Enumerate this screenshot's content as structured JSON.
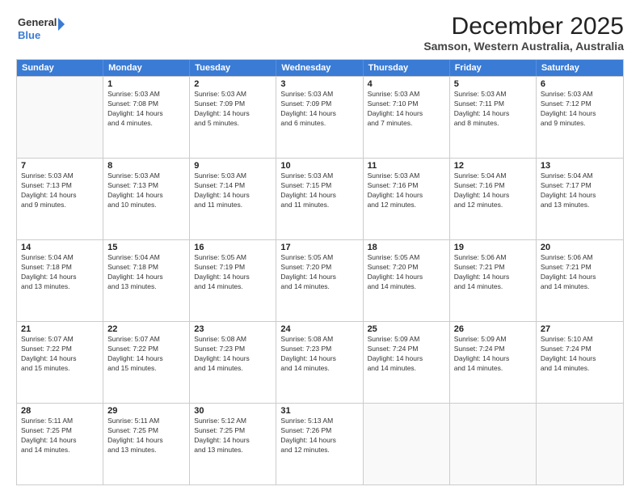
{
  "logo": {
    "line1": "General",
    "line2": "Blue"
  },
  "title": "December 2025",
  "subtitle": "Samson, Western Australia, Australia",
  "days_of_week": [
    "Sunday",
    "Monday",
    "Tuesday",
    "Wednesday",
    "Thursday",
    "Friday",
    "Saturday"
  ],
  "weeks": [
    [
      {
        "day": "",
        "info": ""
      },
      {
        "day": "1",
        "info": "Sunrise: 5:03 AM\nSunset: 7:08 PM\nDaylight: 14 hours\nand 4 minutes."
      },
      {
        "day": "2",
        "info": "Sunrise: 5:03 AM\nSunset: 7:09 PM\nDaylight: 14 hours\nand 5 minutes."
      },
      {
        "day": "3",
        "info": "Sunrise: 5:03 AM\nSunset: 7:09 PM\nDaylight: 14 hours\nand 6 minutes."
      },
      {
        "day": "4",
        "info": "Sunrise: 5:03 AM\nSunset: 7:10 PM\nDaylight: 14 hours\nand 7 minutes."
      },
      {
        "day": "5",
        "info": "Sunrise: 5:03 AM\nSunset: 7:11 PM\nDaylight: 14 hours\nand 8 minutes."
      },
      {
        "day": "6",
        "info": "Sunrise: 5:03 AM\nSunset: 7:12 PM\nDaylight: 14 hours\nand 9 minutes."
      }
    ],
    [
      {
        "day": "7",
        "info": "Sunrise: 5:03 AM\nSunset: 7:13 PM\nDaylight: 14 hours\nand 9 minutes."
      },
      {
        "day": "8",
        "info": "Sunrise: 5:03 AM\nSunset: 7:13 PM\nDaylight: 14 hours\nand 10 minutes."
      },
      {
        "day": "9",
        "info": "Sunrise: 5:03 AM\nSunset: 7:14 PM\nDaylight: 14 hours\nand 11 minutes."
      },
      {
        "day": "10",
        "info": "Sunrise: 5:03 AM\nSunset: 7:15 PM\nDaylight: 14 hours\nand 11 minutes."
      },
      {
        "day": "11",
        "info": "Sunrise: 5:03 AM\nSunset: 7:16 PM\nDaylight: 14 hours\nand 12 minutes."
      },
      {
        "day": "12",
        "info": "Sunrise: 5:04 AM\nSunset: 7:16 PM\nDaylight: 14 hours\nand 12 minutes."
      },
      {
        "day": "13",
        "info": "Sunrise: 5:04 AM\nSunset: 7:17 PM\nDaylight: 14 hours\nand 13 minutes."
      }
    ],
    [
      {
        "day": "14",
        "info": "Sunrise: 5:04 AM\nSunset: 7:18 PM\nDaylight: 14 hours\nand 13 minutes."
      },
      {
        "day": "15",
        "info": "Sunrise: 5:04 AM\nSunset: 7:18 PM\nDaylight: 14 hours\nand 13 minutes."
      },
      {
        "day": "16",
        "info": "Sunrise: 5:05 AM\nSunset: 7:19 PM\nDaylight: 14 hours\nand 14 minutes."
      },
      {
        "day": "17",
        "info": "Sunrise: 5:05 AM\nSunset: 7:20 PM\nDaylight: 14 hours\nand 14 minutes."
      },
      {
        "day": "18",
        "info": "Sunrise: 5:05 AM\nSunset: 7:20 PM\nDaylight: 14 hours\nand 14 minutes."
      },
      {
        "day": "19",
        "info": "Sunrise: 5:06 AM\nSunset: 7:21 PM\nDaylight: 14 hours\nand 14 minutes."
      },
      {
        "day": "20",
        "info": "Sunrise: 5:06 AM\nSunset: 7:21 PM\nDaylight: 14 hours\nand 14 minutes."
      }
    ],
    [
      {
        "day": "21",
        "info": "Sunrise: 5:07 AM\nSunset: 7:22 PM\nDaylight: 14 hours\nand 15 minutes."
      },
      {
        "day": "22",
        "info": "Sunrise: 5:07 AM\nSunset: 7:22 PM\nDaylight: 14 hours\nand 15 minutes."
      },
      {
        "day": "23",
        "info": "Sunrise: 5:08 AM\nSunset: 7:23 PM\nDaylight: 14 hours\nand 14 minutes."
      },
      {
        "day": "24",
        "info": "Sunrise: 5:08 AM\nSunset: 7:23 PM\nDaylight: 14 hours\nand 14 minutes."
      },
      {
        "day": "25",
        "info": "Sunrise: 5:09 AM\nSunset: 7:24 PM\nDaylight: 14 hours\nand 14 minutes."
      },
      {
        "day": "26",
        "info": "Sunrise: 5:09 AM\nSunset: 7:24 PM\nDaylight: 14 hours\nand 14 minutes."
      },
      {
        "day": "27",
        "info": "Sunrise: 5:10 AM\nSunset: 7:24 PM\nDaylight: 14 hours\nand 14 minutes."
      }
    ],
    [
      {
        "day": "28",
        "info": "Sunrise: 5:11 AM\nSunset: 7:25 PM\nDaylight: 14 hours\nand 14 minutes."
      },
      {
        "day": "29",
        "info": "Sunrise: 5:11 AM\nSunset: 7:25 PM\nDaylight: 14 hours\nand 13 minutes."
      },
      {
        "day": "30",
        "info": "Sunrise: 5:12 AM\nSunset: 7:25 PM\nDaylight: 14 hours\nand 13 minutes."
      },
      {
        "day": "31",
        "info": "Sunrise: 5:13 AM\nSunset: 7:26 PM\nDaylight: 14 hours\nand 12 minutes."
      },
      {
        "day": "",
        "info": ""
      },
      {
        "day": "",
        "info": ""
      },
      {
        "day": "",
        "info": ""
      }
    ]
  ]
}
